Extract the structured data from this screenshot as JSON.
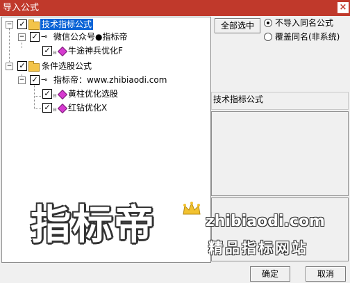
{
  "window": {
    "title": "导入公式",
    "close_glyph": "×"
  },
  "tree": {
    "nodes": [
      {
        "label": "技术指标公式",
        "checked": true,
        "expanded": true,
        "icon": "folder-icon",
        "selected": true
      },
      {
        "label": "微信公众号●指标帝",
        "checked": true,
        "expanded": true,
        "icon": "key-icon"
      },
      {
        "label": "牛途神兵优化F",
        "checked": true,
        "icon": "formula-gem-icon"
      },
      {
        "label": "条件选股公式",
        "checked": true,
        "expanded": true,
        "icon": "folder-icon"
      },
      {
        "label": "指标帝：www.zhibiaodi.com",
        "checked": true,
        "expanded": true,
        "icon": "key-icon"
      },
      {
        "label": "黄柱优化选股",
        "checked": true,
        "icon": "formula-gem-icon"
      },
      {
        "label": "红钻优化X",
        "checked": true,
        "icon": "formula-gem-icon"
      }
    ],
    "check_glyph": "✓",
    "expand_glyph": "−"
  },
  "options": {
    "select_all_label": "全部选中",
    "radio_skip_label": "不导入同名公式",
    "radio_overwrite_label": "覆盖同名(非系统)",
    "selected": "skip"
  },
  "detail": {
    "type_label": "技术指标公式"
  },
  "buttons": {
    "ok_label": "确定",
    "cancel_label": "取消"
  },
  "watermark": {
    "big": "指标帝",
    "url": "zhibiaodi.com",
    "sub": "精品指标网站"
  },
  "colors": {
    "titlebar": "#c0392b",
    "selection": "#0a63d6",
    "formula_icon": "#d63ad0",
    "folder": "#f3c44a"
  }
}
